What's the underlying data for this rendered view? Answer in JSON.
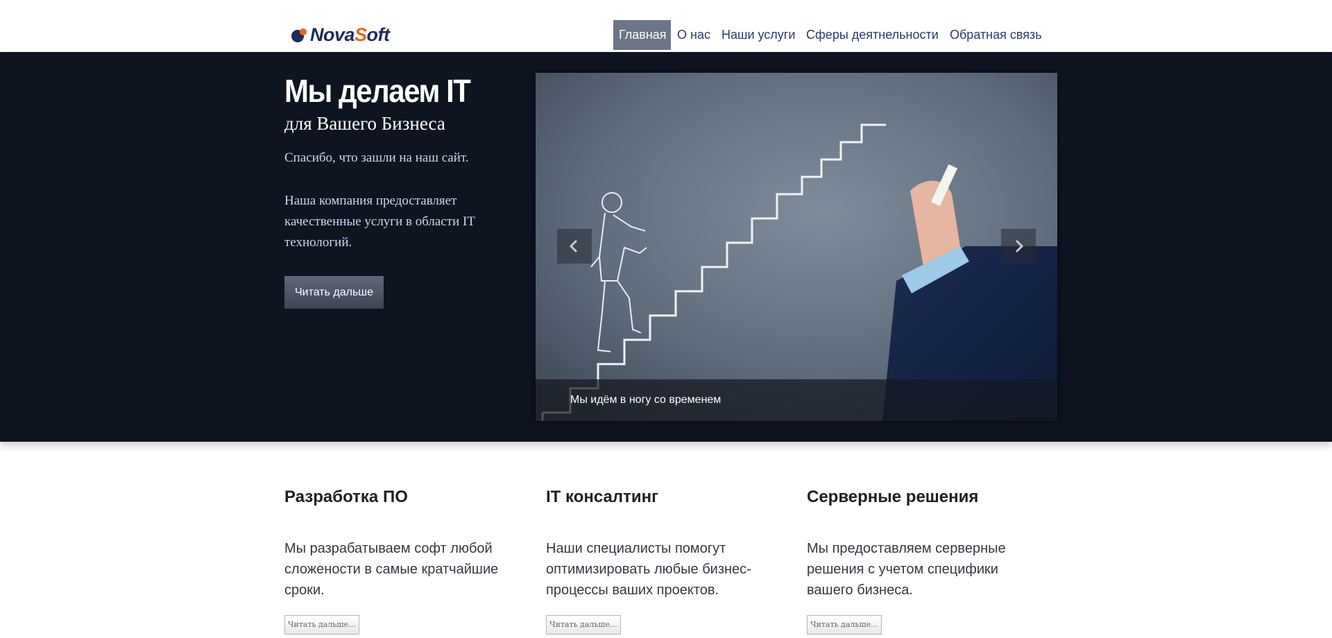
{
  "header": {
    "logo": {
      "part1": "Nova",
      "part2_s": "S",
      "part2": "oft"
    },
    "nav": [
      {
        "label": "Главная",
        "active": true
      },
      {
        "label": "О нас",
        "active": false
      },
      {
        "label": "Наши услуги",
        "active": false
      },
      {
        "label": "Сферы деятнельности",
        "active": false
      },
      {
        "label": "Обратная связь",
        "active": false
      }
    ]
  },
  "hero": {
    "title": "Мы делаем IT",
    "subtitle": "для Вашего Бизнеса",
    "text1": "Спасибо, что зашли на наш сайт.",
    "text2": "Наша компания предоставляет качественные услуги в области IT технологий.",
    "button": "Читать дальше",
    "carousel": {
      "caption": "Мы идём в ногу со временем",
      "prev_icon": "chevron-left-icon",
      "next_icon": "chevron-right-icon"
    }
  },
  "features": [
    {
      "title": "Разработка ПО",
      "text": "Мы разрабатываем софт любой сложености в самые кратчайшие сроки.",
      "button": "Читать дальше..."
    },
    {
      "title": "IT консалтинг",
      "text": "Наши специалисты помогут оптимизировать любые бизнес-процессы ваших проектов.",
      "button": "Читать дальше..."
    },
    {
      "title": "Серверные решения",
      "text": "Мы предоставляем серверные решения с учетом специфики вашего бизнеса.",
      "button": "Читать дальше..."
    }
  ],
  "colors": {
    "hero_bg": "#0e1420",
    "nav_active_bg": "#6c7487",
    "nav_text": "#2b3a6b",
    "logo_accent": "#e8641c",
    "logo_dark": "#1e2a5a"
  }
}
